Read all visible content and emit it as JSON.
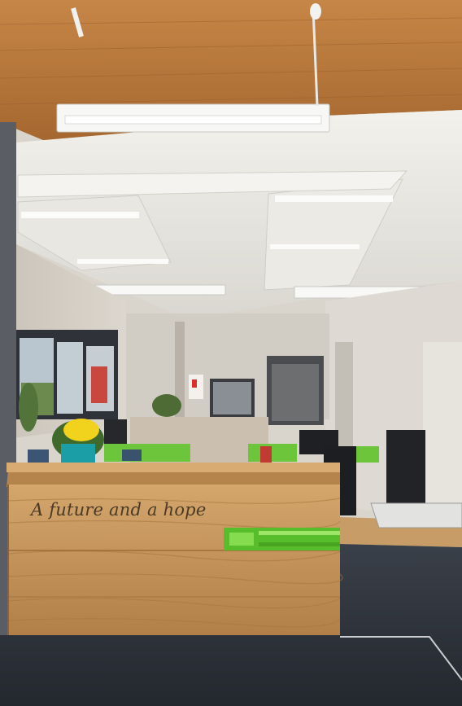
{
  "photo": {
    "subject": "office reception area",
    "colors": {
      "wood_ceiling": "#b5773d",
      "ceiling": "#e6e4de",
      "walls": "#d8d4cc",
      "desk_wood": "#c89a62",
      "accent_green": "#5cc12c",
      "carpet": "#2d333d"
    }
  },
  "desk": {
    "slogan": "A future and a hope"
  }
}
